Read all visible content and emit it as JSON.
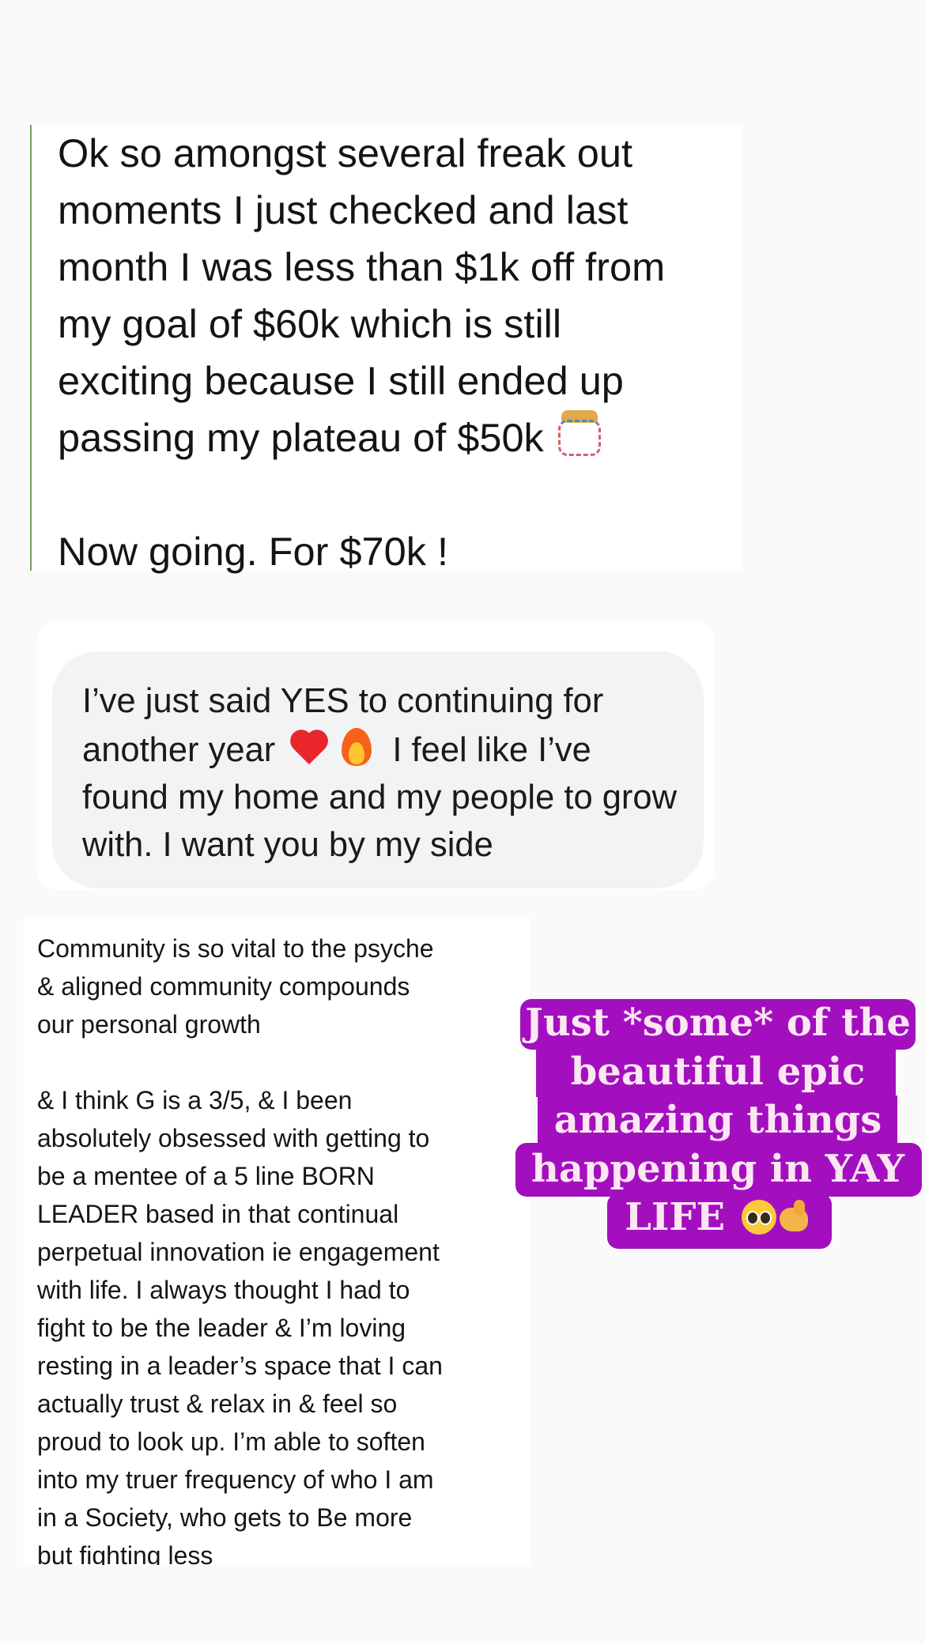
{
  "testimonials": [
    {
      "kind": "quoted-message",
      "text_main": "Ok so amongst several freak out\nmoments I just checked and last\nmonth I was less than $1k off from\nmy goal of $60k which is still\nexciting because I still ended up\npassing my plateau of $50k ",
      "icon": "confetti-icon",
      "text_after": "\n\nNow going. For $70k !"
    },
    {
      "kind": "chat-bubble",
      "text_before": "I’ve just said YES to continuing for another year ",
      "icons": [
        "red-heart-icon",
        "fire-icon"
      ],
      "text_after": " I feel like I’ve found my home and my people to grow with. I want you by my side"
    },
    {
      "kind": "note",
      "text": "Community is so vital to the psyche\n& aligned community compounds\nour personal growth\n\n& I think G is a 3/5, & I been\nabsolutely obsessed with getting to\nbe a mentee of a 5 line BORN\nLEADER based in that continual\nperpetual innovation ie engagement\nwith life. I always thought I had to\nfight to be the leader & I’m loving\nresting in a leader’s space that I can\nactually trust & relax in & feel so\nproud to look up. I’m able to soften\ninto my truer frequency of who I am\nin a Society, who gets to Be more\nbut fighting less"
    }
  ],
  "headline": {
    "lines": [
      "Just *some* of the",
      "beautiful epic",
      "amazing things",
      "happening in YAY",
      "LIFE "
    ],
    "icons": [
      "pleading-face-icon",
      "pinching-hand-icon"
    ],
    "background": "#a30fbf",
    "text_color": "#fbe6f2"
  }
}
